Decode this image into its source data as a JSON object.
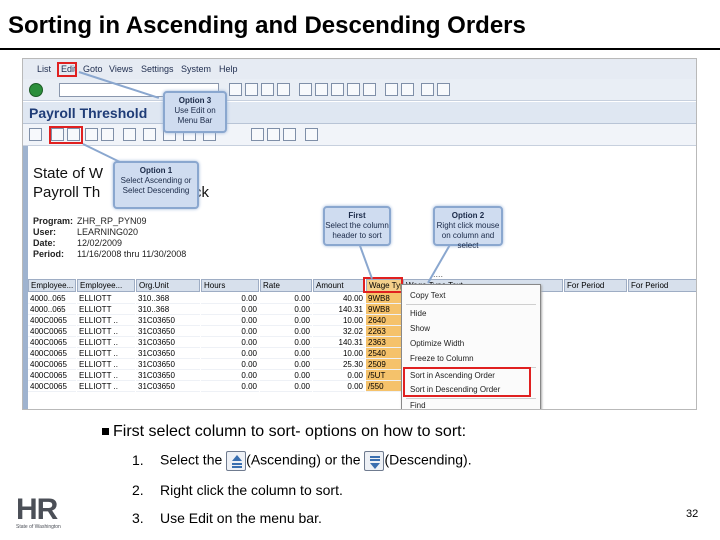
{
  "slide": {
    "title": "Sorting in Ascending and Descending Orders",
    "page_number": "32"
  },
  "sap": {
    "menu": [
      "List",
      "Edit",
      "Goto",
      "Views",
      "Settings",
      "System",
      "Help"
    ],
    "app_title": "Payroll Threshold",
    "report_title_1": "State of W",
    "report_title_2": "Payroll Th",
    "report_title_2_tail": "ck",
    "program_label": "Program:",
    "program_value": "ZHR_RP_PYN09",
    "user_label": "User:",
    "user_value": "LEARNING020",
    "date_label": "Date:",
    "date_value": "12/02/2009",
    "period_label": "Period:",
    "period_value": "11/16/2008 thru 11/30/2008",
    "dots": "....",
    "table": {
      "headers": [
        "Employee...",
        "Employee...",
        "Org.Unit",
        "Hours",
        "Rate",
        "Amount",
        "Wage Type",
        "Wage Type Text",
        "For Period",
        "For Period"
      ],
      "rows": [
        [
          "4000..065",
          "ELLIOTT",
          "310..368",
          "0.00",
          "0.00",
          "40.00",
          "9WB8"
        ],
        [
          "4000..065",
          "ELLIOTT",
          "310..368",
          "0.00",
          "0.00",
          "140.31",
          "9WB8"
        ],
        [
          "400C0065",
          "ELLIOTT ..",
          "31C03650",
          "0.00",
          "0.00",
          "10.00",
          "2640"
        ],
        [
          "400C0065",
          "ELLIOTT ..",
          "31C03650",
          "0.00",
          "0.00",
          "32.02",
          "2263"
        ],
        [
          "400C0065",
          "ELLIOTT ..",
          "31C03650",
          "0.00",
          "0.00",
          "140.31",
          "2363"
        ],
        [
          "400C0065",
          "ELLIOTT ..",
          "31C03650",
          "0.00",
          "0.00",
          "10.00",
          "2540"
        ],
        [
          "400C0065",
          "ELLIOTT ..",
          "31C03650",
          "0.00",
          "0.00",
          "25.30",
          "2509"
        ],
        [
          "400C0065",
          "ELLIOTT ..",
          "31C03650",
          "0.00",
          "0.00",
          "0.00",
          "/5UT"
        ],
        [
          "400C0065",
          "ELLIOTT ..",
          "31C03650",
          "0.00",
          "0.00",
          "0.00",
          "/550"
        ]
      ]
    },
    "context_menu": [
      "Copy Text",
      "Hide",
      "Show",
      "Optimize Width",
      "Freeze to Column",
      "Sort in Ascending Order",
      "Sort in Descending Order",
      "Find"
    ]
  },
  "callouts": {
    "option3": {
      "title": "Option 3",
      "body": "Use Edit on Menu Bar"
    },
    "option1": {
      "title": "Option 1",
      "body": "Select Ascending or Select Descending"
    },
    "first": {
      "title": "First",
      "body": "Select the column header to sort"
    },
    "option2": {
      "title": "Option 2",
      "body": "Right click mouse on column and select"
    }
  },
  "instructions": {
    "main": "First select column to sort- options on how to sort:",
    "step1_num": "1.",
    "step1_pre": "Select the",
    "step1_mid": "(Ascending) or the",
    "step1_post": "(Descending).",
    "step2_num": "2.",
    "step2": "Right click the column to sort.",
    "step3_num": "3.",
    "step3": "Use Edit on the menu bar."
  },
  "logo": {
    "text": "HR",
    "sub": "State of Washington"
  },
  "colors": {
    "highlight_red": "#e02020",
    "wage_column": "#f5c26b",
    "callout_fill": "#cfdcf0"
  }
}
